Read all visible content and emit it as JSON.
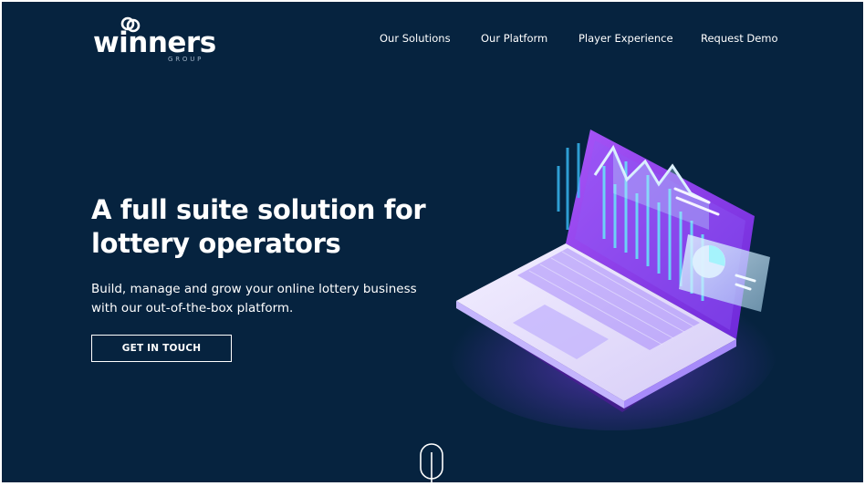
{
  "brand": {
    "name": "winners",
    "subtitle": "GROUP"
  },
  "nav": {
    "items": [
      {
        "label": "Our Solutions"
      },
      {
        "label": "Our Platform"
      },
      {
        "label": "Player Experience"
      },
      {
        "label": "Request Demo"
      }
    ]
  },
  "hero": {
    "title_line1": "A full suite solution for",
    "title_line2": "lottery operators",
    "subtitle_line1": "Build, manage and grow your online lottery business",
    "subtitle_line2": "with our out-of-the-box platform.",
    "cta_label": "GET IN TOUCH"
  },
  "colors": {
    "background": "#06233f",
    "text": "#ffffff",
    "accent_purple": "#8b5cf6",
    "accent_cyan": "#38bdf8"
  },
  "icons": {
    "logo_mark": "linked-rings-icon",
    "scroll": "scroll-down-icon"
  }
}
